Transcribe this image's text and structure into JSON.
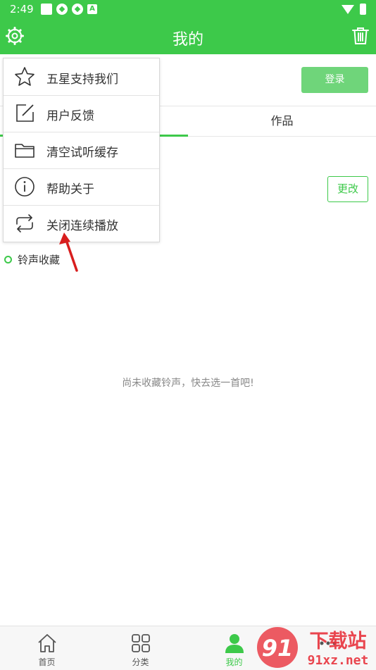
{
  "status_bar": {
    "time": "2:49"
  },
  "header": {
    "title": "我的"
  },
  "account": {
    "login_label": "登录",
    "change_label": "更改"
  },
  "tabs": {
    "works": "作品"
  },
  "favorites": {
    "header": "铃声收藏",
    "empty_message": "尚未收藏铃声，快去选一首吧!"
  },
  "menu": {
    "items": [
      {
        "label": "五星支持我们",
        "icon": "star-icon"
      },
      {
        "label": "用户反馈",
        "icon": "edit-icon"
      },
      {
        "label": "清空试听缓存",
        "icon": "folder-icon"
      },
      {
        "label": "帮助关于",
        "icon": "info-icon"
      },
      {
        "label": "关闭连续播放",
        "icon": "repeat-icon"
      }
    ]
  },
  "bottom_nav": {
    "items": [
      {
        "label": "首页",
        "icon": "home-icon"
      },
      {
        "label": "分类",
        "icon": "grid-icon"
      },
      {
        "label": "我的",
        "icon": "person-icon",
        "active": true
      },
      {
        "label": "",
        "icon": "more-icon"
      }
    ]
  },
  "watermark": {
    "brand": "下载站",
    "url": "91xz.net"
  },
  "colors": {
    "primary": "#3dc94a",
    "login_button": "#6fd57a",
    "annotation": "#d81e1e"
  }
}
